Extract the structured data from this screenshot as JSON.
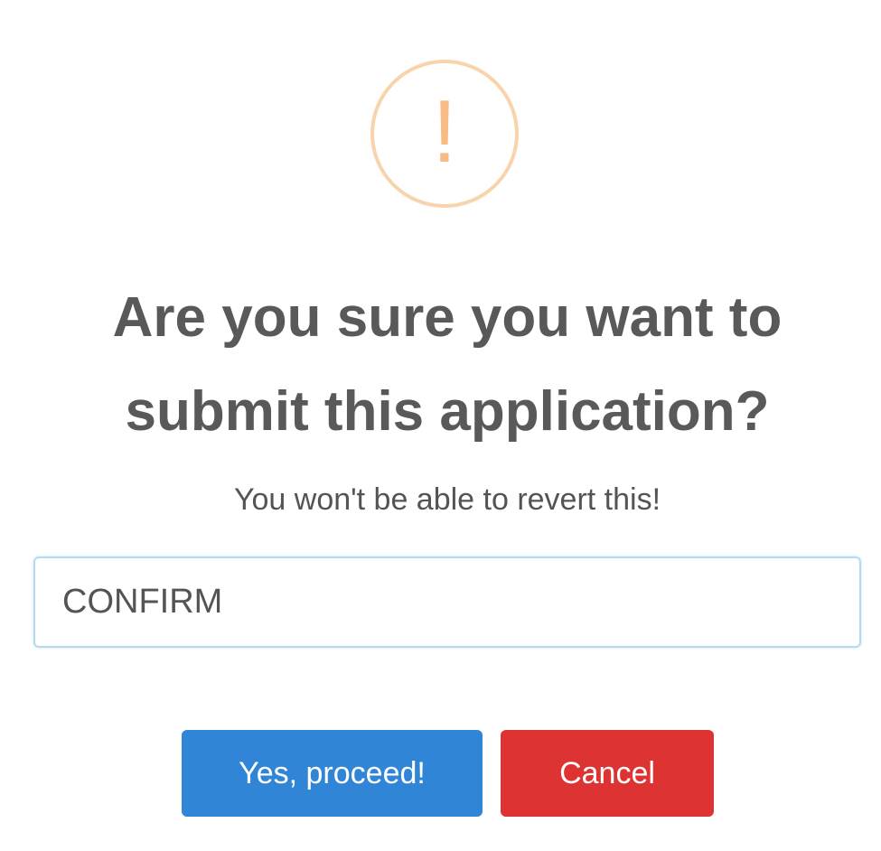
{
  "dialog": {
    "icon": {
      "name": "warning-icon",
      "glyph": "!",
      "color": "#f8bb86",
      "border_color": "#f8d4ad"
    },
    "title_line1": "Are you sure you want to",
    "title_line2": "submit this application?",
    "text": "You won't be able to revert this!",
    "input": {
      "value": "CONFIRM",
      "border_color": "#b4dbed"
    },
    "buttons": {
      "confirm_label": "Yes, proceed!",
      "confirm_color": "#3085d6",
      "cancel_label": "Cancel",
      "cancel_color": "#dd3333"
    },
    "title_color": "#595959",
    "text_color": "#545454"
  }
}
